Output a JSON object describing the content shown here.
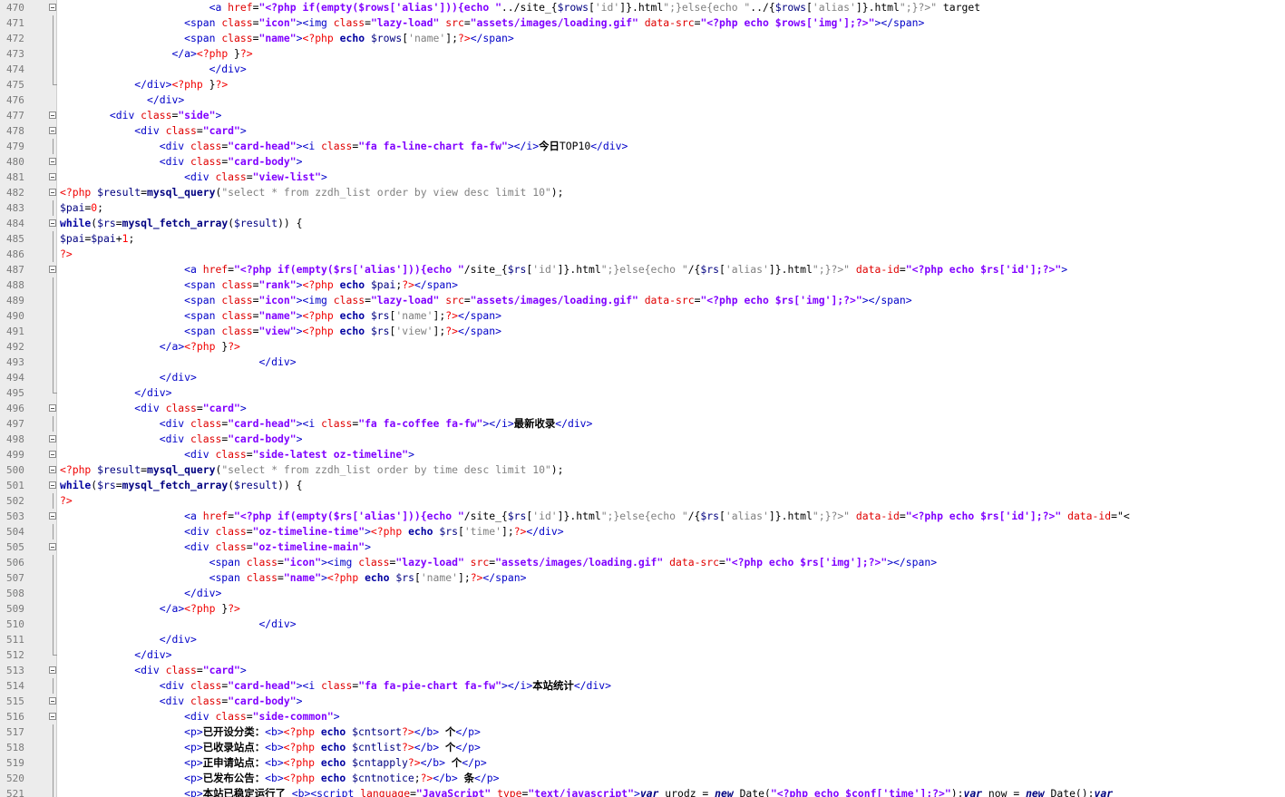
{
  "editor": {
    "lines": [
      {
        "no": "470",
        "fold": "box",
        "text": "                        <a href=\"<?php if(empty($rows['alias'])){echo \"../site_{$rows['id']}.html\";}else{echo \"../{$rows['alias']}.html\";}?>\" target"
      },
      {
        "no": "471",
        "fold": "line",
        "text": "                    <span class=\"icon\"><img class=\"lazy-load\" src=\"assets/images/loading.gif\" data-src=\"<?php echo $rows['img'];?>\"></span>"
      },
      {
        "no": "472",
        "fold": "line",
        "text": "                    <span class=\"name\"><?php echo $rows['name'];?></span>"
      },
      {
        "no": "473",
        "fold": "line",
        "text": "                  </a><?php }?>"
      },
      {
        "no": "474",
        "fold": "line",
        "text": "                        </div>"
      },
      {
        "no": "475",
        "fold": "end",
        "text": "            </div><?php }?>"
      },
      {
        "no": "476",
        "fold": "none",
        "text": "              </div>"
      },
      {
        "no": "477",
        "fold": "box",
        "text": "        <div class=\"side\">"
      },
      {
        "no": "478",
        "fold": "box",
        "text": "            <div class=\"card\">"
      },
      {
        "no": "479",
        "fold": "line",
        "text": "                <div class=\"card-head\"><i class=\"fa fa-line-chart fa-fw\"></i>今日TOP10</div>"
      },
      {
        "no": "480",
        "fold": "box",
        "text": "                <div class=\"card-body\">"
      },
      {
        "no": "481",
        "fold": "box",
        "text": "                    <div class=\"view-list\">"
      },
      {
        "no": "482",
        "fold": "box",
        "text": "<?php $result=mysql_query(\"select * from zzdh_list order by view desc limit 10\");"
      },
      {
        "no": "483",
        "fold": "line",
        "text": "$pai=0;"
      },
      {
        "no": "484",
        "fold": "box",
        "text": "while($rs=mysql_fetch_array($result)) {"
      },
      {
        "no": "485",
        "fold": "line",
        "text": "$pai=$pai+1;"
      },
      {
        "no": "486",
        "fold": "line",
        "text": "?>"
      },
      {
        "no": "487",
        "fold": "box",
        "text": "                    <a href=\"<?php if(empty($rs['alias'])){echo \"/site_{$rs['id']}.html\";}else{echo \"/{$rs['alias']}.html\";}?>\" data-id=\"<?php echo $rs['id'];?>\">"
      },
      {
        "no": "488",
        "fold": "line",
        "text": "                    <span class=\"rank\"><?php echo $pai;?></span>"
      },
      {
        "no": "489",
        "fold": "line",
        "text": "                    <span class=\"icon\"><img class=\"lazy-load\" src=\"assets/images/loading.gif\" data-src=\"<?php echo $rs['img'];?>\"></span>"
      },
      {
        "no": "490",
        "fold": "line",
        "text": "                    <span class=\"name\"><?php echo $rs['name'];?></span>"
      },
      {
        "no": "491",
        "fold": "line",
        "text": "                    <span class=\"view\"><?php echo $rs['view'];?></span>"
      },
      {
        "no": "492",
        "fold": "line",
        "text": "                </a><?php }?>"
      },
      {
        "no": "493",
        "fold": "line",
        "text": "                                </div>"
      },
      {
        "no": "494",
        "fold": "line",
        "text": "                </div>"
      },
      {
        "no": "495",
        "fold": "end",
        "text": "            </div>"
      },
      {
        "no": "496",
        "fold": "box",
        "text": "            <div class=\"card\">"
      },
      {
        "no": "497",
        "fold": "line",
        "text": "                <div class=\"card-head\"><i class=\"fa fa-coffee fa-fw\"></i>最新收录</div>"
      },
      {
        "no": "498",
        "fold": "box",
        "text": "                <div class=\"card-body\">"
      },
      {
        "no": "499",
        "fold": "box",
        "text": "                    <div class=\"side-latest oz-timeline\">"
      },
      {
        "no": "500",
        "fold": "box",
        "text": "<?php $result=mysql_query(\"select * from zzdh_list order by time desc limit 10\");"
      },
      {
        "no": "501",
        "fold": "box",
        "text": "while($rs=mysql_fetch_array($result)) {"
      },
      {
        "no": "502",
        "fold": "line",
        "text": "?>"
      },
      {
        "no": "503",
        "fold": "box",
        "text": "                    <a href=\"<?php if(empty($rs['alias'])){echo \"/site_{$rs['id']}.html\";}else{echo \"/{$rs['alias']}.html\";}?>\" data-id=\"<?php echo $rs['id'];?>\" data-id=\"<"
      },
      {
        "no": "504",
        "fold": "line",
        "text": "                    <div class=\"oz-timeline-time\"><?php echo $rs['time'];?></div>"
      },
      {
        "no": "505",
        "fold": "box",
        "text": "                    <div class=\"oz-timeline-main\">"
      },
      {
        "no": "506",
        "fold": "line",
        "text": "                        <span class=\"icon\"><img class=\"lazy-load\" src=\"assets/images/loading.gif\" data-src=\"<?php echo $rs['img'];?>\"></span>"
      },
      {
        "no": "507",
        "fold": "line",
        "text": "                        <span class=\"name\"><?php echo $rs['name'];?></span>"
      },
      {
        "no": "508",
        "fold": "line",
        "text": "                    </div>"
      },
      {
        "no": "509",
        "fold": "line",
        "text": "                </a><?php }?>"
      },
      {
        "no": "510",
        "fold": "line",
        "text": "                                </div>"
      },
      {
        "no": "511",
        "fold": "line",
        "text": "                </div>"
      },
      {
        "no": "512",
        "fold": "end",
        "text": "            </div>"
      },
      {
        "no": "513",
        "fold": "box",
        "text": "            <div class=\"card\">"
      },
      {
        "no": "514",
        "fold": "line",
        "text": "                <div class=\"card-head\"><i class=\"fa fa-pie-chart fa-fw\"></i>本站统计</div>"
      },
      {
        "no": "515",
        "fold": "box",
        "text": "                <div class=\"card-body\">"
      },
      {
        "no": "516",
        "fold": "box",
        "text": "                    <div class=\"side-common\">"
      },
      {
        "no": "517",
        "fold": "line",
        "text": "                    <p>已开设分类：<b><?php echo $cntsort?></b> 个</p>"
      },
      {
        "no": "518",
        "fold": "line",
        "text": "                    <p>已收录站点：<b><?php echo $cntlist?></b> 个</p>"
      },
      {
        "no": "519",
        "fold": "line",
        "text": "                    <p>正申请站点：<b><?php echo $cntapply?></b> 个</p>"
      },
      {
        "no": "520",
        "fold": "line",
        "text": "                    <p>已发布公告：<b><?php echo $cntnotice;?></b> 条</p>"
      },
      {
        "no": "521",
        "fold": "line",
        "text": "                    <p>本站已稳定运行了 <b><script language=\"JavaScript\" type=\"text/javascript\">var urodz = new Date(\"<?php echo $conf['time'];?>\");var now = new Date();var"
      }
    ]
  }
}
